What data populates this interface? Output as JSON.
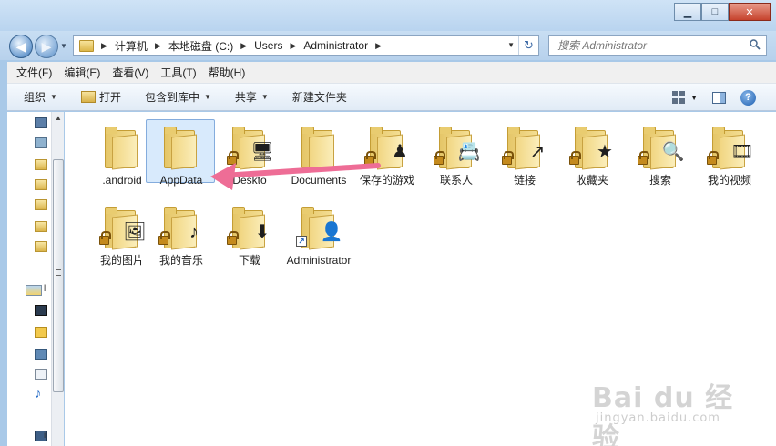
{
  "window": {
    "min_glyph": "▁",
    "max_glyph": "□",
    "close_glyph": "✕"
  },
  "address": {
    "back_glyph": "◀",
    "forward_glyph": "▶",
    "crumbs": [
      "计算机",
      "本地磁盘 (C:)",
      "Users",
      "Administrator"
    ],
    "refresh_glyph": "↻",
    "search_placeholder": "搜索 Administrator"
  },
  "menu": [
    "文件(F)",
    "编辑(E)",
    "查看(V)",
    "工具(T)",
    "帮助(H)"
  ],
  "toolbar": {
    "organize": "组织",
    "open": "打开",
    "include_library": "包含到库中",
    "share": "共享",
    "new_folder": "新建文件夹",
    "help_glyph": "?"
  },
  "navpane": {
    "fragment_1": "l",
    "fragment_2": "i"
  },
  "items": [
    {
      "label": ".android",
      "overlay": "",
      "badge": "none",
      "icon": "folder-icon"
    },
    {
      "label": "AppData",
      "overlay": "",
      "badge": "none",
      "icon": "folder-icon",
      "selected": true
    },
    {
      "label": "Deskto",
      "overlay": "🖥",
      "badge": "lock",
      "icon": "desktop-folder-icon"
    },
    {
      "label": "Documents",
      "overlay": "",
      "badge": "none",
      "icon": "documents-folder-icon"
    },
    {
      "label": "保存的游戏",
      "overlay": "♟",
      "badge": "lock",
      "icon": "saved-games-folder-icon"
    },
    {
      "label": "联系人",
      "overlay": "📇",
      "badge": "lock",
      "icon": "contacts-folder-icon"
    },
    {
      "label": "链接",
      "overlay": "↗",
      "badge": "lock",
      "icon": "links-folder-icon"
    },
    {
      "label": "收藏夹",
      "overlay": "★",
      "badge": "lock",
      "icon": "favorites-folder-icon"
    },
    {
      "label": "搜索",
      "overlay": "🔍",
      "badge": "lock",
      "icon": "searches-folder-icon"
    },
    {
      "label": "我的视频",
      "overlay": "🎞",
      "badge": "lock",
      "icon": "videos-folder-icon"
    },
    {
      "label": "我的图片",
      "overlay": "🖼",
      "badge": "lock",
      "icon": "pictures-folder-icon"
    },
    {
      "label": "我的音乐",
      "overlay": "♪",
      "badge": "lock",
      "icon": "music-folder-icon"
    },
    {
      "label": "下载",
      "overlay": "⬇",
      "badge": "lock",
      "icon": "downloads-folder-icon"
    },
    {
      "label": "Administrator",
      "overlay": "👤",
      "badge": "shortcut",
      "icon": "user-shortcut-icon"
    }
  ],
  "annotation": {
    "color": "#ee6d96"
  },
  "watermark": {
    "brand": "Bai du 经验",
    "url": "jingyan.baidu.com"
  }
}
